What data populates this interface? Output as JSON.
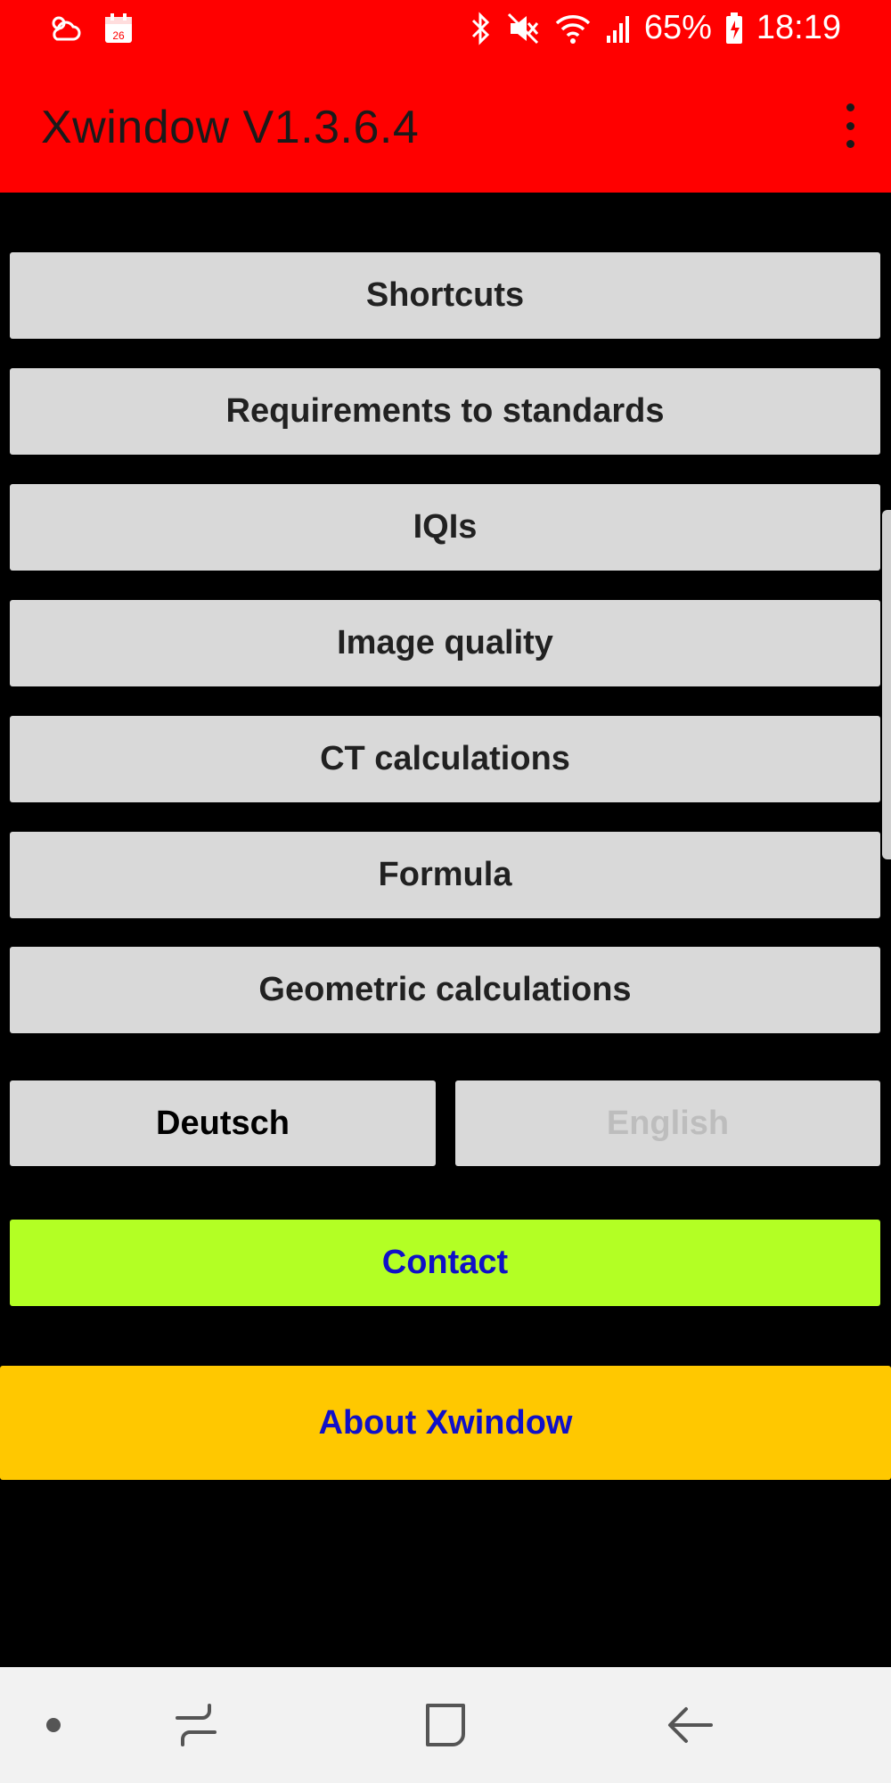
{
  "status_bar": {
    "battery": "65%",
    "time": "18:19",
    "calendar_day": "26"
  },
  "app_bar": {
    "title": "Xwindow V1.3.6.4"
  },
  "menu": {
    "shortcuts": "Shortcuts",
    "requirements": "Requirements to standards",
    "iqis": "IQIs",
    "image_quality": "Image quality",
    "ct_calculations": "CT calculations",
    "formula": "Formula",
    "geometric_calculations": "Geometric calculations"
  },
  "language": {
    "deutsch": "Deutsch",
    "english": "English"
  },
  "actions": {
    "contact": "Contact",
    "about": "About Xwindow"
  },
  "colors": {
    "app_bar": "#ff0000",
    "background": "#000000",
    "button": "#d9d9d9",
    "contact": "#b3ff24",
    "about": "#ffc800",
    "accent_text": "#1010c8"
  }
}
